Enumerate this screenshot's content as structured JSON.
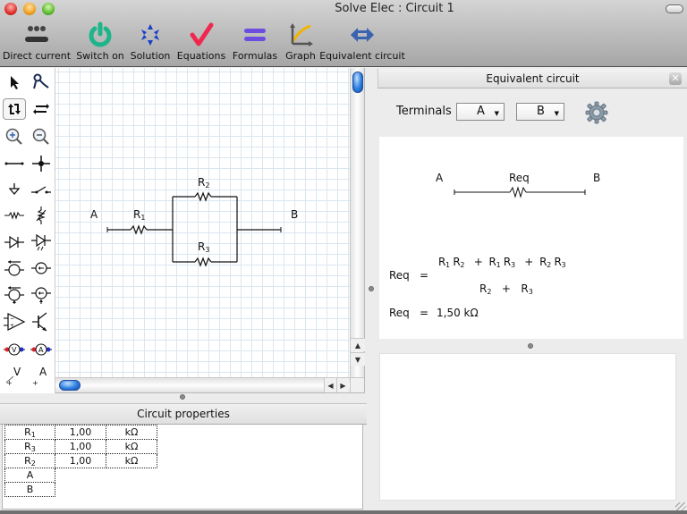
{
  "window": {
    "title": "Solve Elec : Circuit 1"
  },
  "toolbar": {
    "items": [
      {
        "label": "Direct current",
        "icon": "direct-current-icon"
      },
      {
        "label": "Switch on",
        "icon": "power-icon"
      },
      {
        "label": "Solution",
        "icon": "solution-icon"
      },
      {
        "label": "Equations",
        "icon": "checkmark-icon"
      },
      {
        "label": "Formulas",
        "icon": "equals-icon"
      },
      {
        "label": "Graph",
        "icon": "graph-icon"
      },
      {
        "label": "Equivalent circuit",
        "icon": "equivalent-circuit-icon"
      }
    ]
  },
  "palette": {
    "tools": [
      "pointer-tool",
      "wire-bend-tool",
      "rotate-tool",
      "flip-tool",
      "zoom-in-tool",
      "zoom-out-tool",
      "wire-tool",
      "node-tool",
      "ground-tool",
      "switch-tool",
      "resistor-tool",
      "variable-resistor-tool",
      "diode-tool",
      "led-tool",
      "voltage-source-tool",
      "current-source-tool",
      "controlled-voltage-source-tool",
      "controlled-current-source-tool",
      "op-amp-tool",
      "transistor-tool",
      "voltmeter-tool",
      "ammeter-tool",
      "voltage-label-tool",
      "current-label-tool"
    ],
    "voltage_label": "V",
    "current_label": "A"
  },
  "circuit": {
    "terminal_a": "A",
    "terminal_b": "B",
    "components": [
      {
        "name": "R",
        "sub": "1"
      },
      {
        "name": "R",
        "sub": "2"
      },
      {
        "name": "R",
        "sub": "3"
      }
    ]
  },
  "circuit_properties": {
    "title": "Circuit properties",
    "rows": [
      {
        "name": "R",
        "sub": "1",
        "value": "1,00",
        "unit": "kΩ"
      },
      {
        "name": "R",
        "sub": "3",
        "value": "1,00",
        "unit": "kΩ"
      },
      {
        "name": "R",
        "sub": "2",
        "value": "1,00",
        "unit": "kΩ"
      },
      {
        "name": "A",
        "sub": "",
        "value": "",
        "unit": ""
      },
      {
        "name": "B",
        "sub": "",
        "value": "",
        "unit": ""
      }
    ]
  },
  "equivalent": {
    "title": "Equivalent circuit",
    "terminals_label": "Terminals",
    "terminal_1": "A",
    "terminal_2": "B",
    "diagram": {
      "left": "A",
      "right": "B",
      "label": "Req"
    },
    "formula": {
      "lhs": "Req",
      "eq": "=",
      "numerator": [
        [
          {
            "name": "R",
            "sub": "1"
          },
          {
            "name": "R",
            "sub": "2"
          }
        ],
        [
          {
            "name": "R",
            "sub": "1"
          },
          {
            "name": "R",
            "sub": "3"
          }
        ],
        [
          {
            "name": "R",
            "sub": "2"
          },
          {
            "name": "R",
            "sub": "3"
          }
        ]
      ],
      "denominator": [
        {
          "name": "R",
          "sub": "2"
        },
        {
          "name": "R",
          "sub": "3"
        }
      ],
      "plus": "+"
    },
    "result": {
      "lhs": "Req",
      "eq": "=",
      "value": "1,50 kΩ"
    }
  }
}
